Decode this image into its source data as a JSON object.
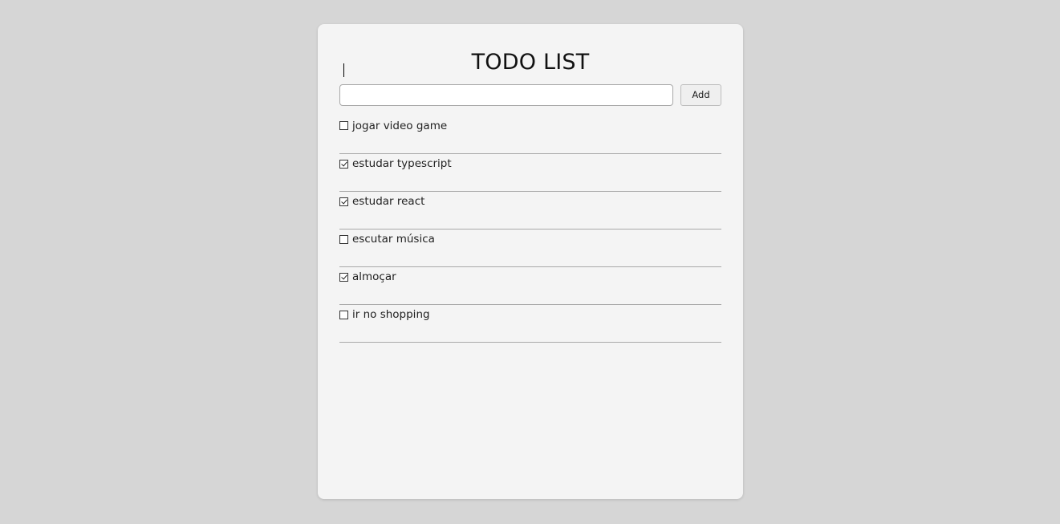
{
  "app": {
    "title": "TODO LIST"
  },
  "form": {
    "input_value": "",
    "input_placeholder": "",
    "add_label": "Add"
  },
  "todos": [
    {
      "text": "jogar video game",
      "done": false
    },
    {
      "text": "estudar typescript",
      "done": true
    },
    {
      "text": "estudar react",
      "done": true
    },
    {
      "text": "escutar música",
      "done": false
    },
    {
      "text": "almoçar",
      "done": true
    },
    {
      "text": "ir no shopping",
      "done": false
    }
  ],
  "colors": {
    "background": "#d6d6d6",
    "card": "#f4f4f4",
    "divider": "#a9a9a9"
  }
}
